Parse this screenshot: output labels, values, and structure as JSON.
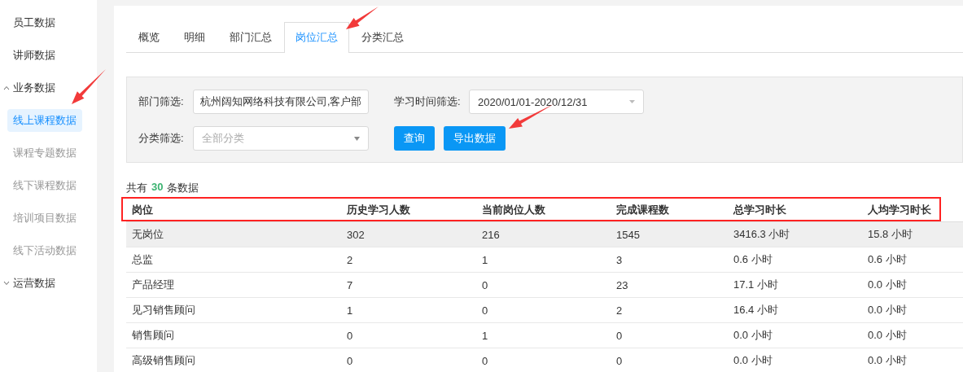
{
  "sidebar": {
    "items": [
      {
        "kind": "link",
        "label": "员工数据"
      },
      {
        "kind": "link",
        "label": "讲师数据"
      },
      {
        "kind": "group",
        "label": "业务数据",
        "expanded": true,
        "children": [
          {
            "label": "线上课程数据",
            "selected": true
          },
          {
            "label": "课程专题数据",
            "selected": false
          },
          {
            "label": "线下课程数据",
            "selected": false
          },
          {
            "label": "培训项目数据",
            "selected": false
          },
          {
            "label": "线下活动数据",
            "selected": false
          }
        ]
      },
      {
        "kind": "group",
        "label": "运营数据",
        "expanded": false
      }
    ]
  },
  "tabs": [
    {
      "label": "概览",
      "selected": false
    },
    {
      "label": "明细",
      "selected": false
    },
    {
      "label": "部门汇总",
      "selected": false
    },
    {
      "label": "岗位汇总",
      "selected": true
    },
    {
      "label": "分类汇总",
      "selected": false
    }
  ],
  "filters": {
    "department": {
      "label": "部门筛选:",
      "value": "杭州阔知网络科技有限公司,客户部"
    },
    "time": {
      "label": "学习时间筛选:",
      "value": "2020/01/01-2020/12/31"
    },
    "category": {
      "label": "分类筛选:",
      "placeholder": "全部分类"
    },
    "buttons": [
      "查询",
      "导出数据"
    ]
  },
  "summary": {
    "prefix": "共有",
    "count": "30",
    "suffix": "条数据"
  },
  "table": {
    "columns": [
      "岗位",
      "历史学习人数",
      "当前岗位人数",
      "完成课程数",
      "总学习时长",
      "人均学习时长"
    ],
    "rows": [
      {
        "hovered": true,
        "cells": [
          "无岗位",
          "302",
          "216",
          "1545",
          "3416.3 小时",
          "15.8 小时"
        ]
      },
      {
        "hovered": false,
        "cells": [
          "总监",
          "2",
          "1",
          "3",
          "0.6 小时",
          "0.6 小时"
        ]
      },
      {
        "hovered": false,
        "cells": [
          "产品经理",
          "7",
          "0",
          "23",
          "17.1 小时",
          "0.0 小时"
        ]
      },
      {
        "hovered": false,
        "cells": [
          "见习销售顾问",
          "1",
          "0",
          "2",
          "16.4 小时",
          "0.0 小时"
        ]
      },
      {
        "hovered": false,
        "cells": [
          "销售顾问",
          "0",
          "1",
          "0",
          "0.0 小时",
          "0.0 小时"
        ]
      },
      {
        "hovered": false,
        "cells": [
          "高级销售顾问",
          "0",
          "0",
          "0",
          "0.0 小时",
          "0.0 小时"
        ]
      }
    ]
  },
  "annotations": [
    {
      "kind": "arrow"
    },
    {
      "kind": "arrow"
    },
    {
      "kind": "arrow"
    },
    {
      "kind": "frame"
    }
  ]
}
